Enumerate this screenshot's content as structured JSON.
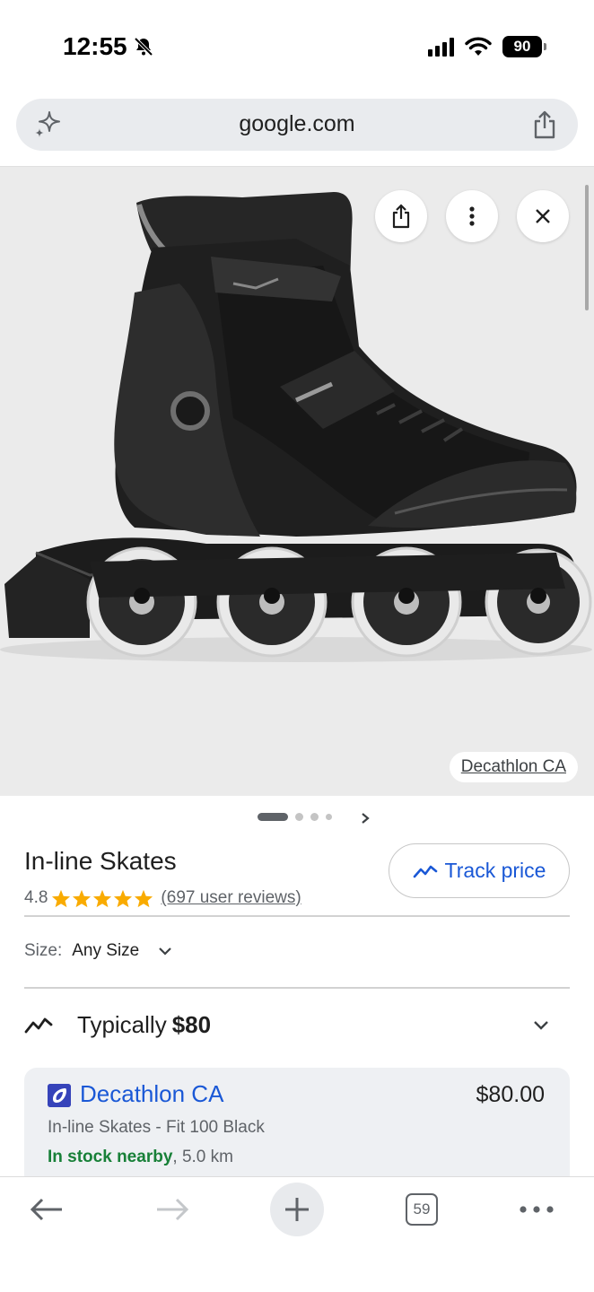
{
  "status_bar": {
    "time": "12:55",
    "battery": "90",
    "icons": [
      "bell-slash-icon",
      "signal-icon",
      "wifi-icon",
      "battery-icon"
    ]
  },
  "url_bar": {
    "url": "google.com",
    "icons": [
      "sparkle-icon",
      "share-icon"
    ]
  },
  "image_viewer": {
    "source": "Decathlon CA",
    "buttons": [
      "share-icon",
      "more-vert-icon",
      "close-icon"
    ],
    "carousel": {
      "count": 4,
      "active_index": 0
    }
  },
  "product": {
    "title": "In-line Skates",
    "rating": "4.8",
    "stars": 5,
    "reviews": "(697 user reviews)",
    "track_price_label": "Track price",
    "size_label": "Size:",
    "size_value": "Any Size",
    "typical_label": "Typically",
    "typical_price": "$80"
  },
  "offer": {
    "merchant": "Decathlon CA",
    "price": "$80.00",
    "product_name": "In-line Skates - Fit 100 Black",
    "stock_status": "In stock nearby",
    "distance": ", 5.0 km"
  },
  "toolbar": {
    "tab_count": "59",
    "items": [
      "back-arrow-icon",
      "forward-arrow-icon",
      "new-tab-icon",
      "tabs-icon",
      "more-horiz-icon"
    ]
  },
  "colors": {
    "link_blue": "#1a58d6",
    "star_yellow": "#f9ab00",
    "in_stock_green": "#188038",
    "decathlon_blue": "#3643ba"
  }
}
